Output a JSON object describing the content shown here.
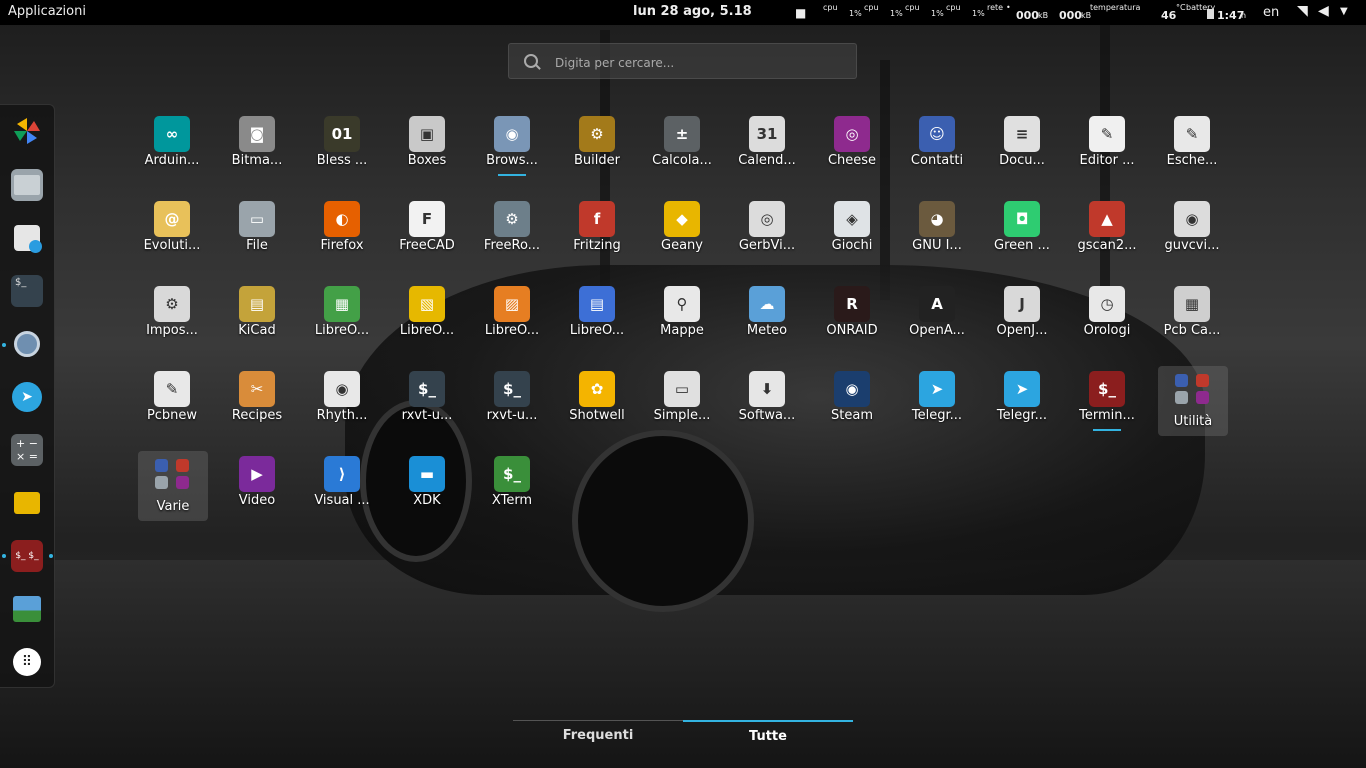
{
  "topbar": {
    "activities": "Applicazioni",
    "clock": "lun 28 ago,  5.18",
    "status": {
      "cpu_label": "cpu",
      "cpu_values": [
        "1%",
        "1%",
        "1%",
        "1%"
      ],
      "net_label": "rete",
      "net_down": "000",
      "net_down_unit": "kB",
      "net_up": "000",
      "net_up_unit": "kB",
      "temp_label": "temperatura",
      "temp_value": "46",
      "temp_unit": "°C",
      "battery_label": "battery",
      "battery_value": "1:47",
      "battery_unit": "h",
      "language": "en"
    }
  },
  "search": {
    "placeholder": "Digita per cercare..."
  },
  "dash": {
    "items": [
      "photos-icon",
      "files-icon",
      "software-icon",
      "terminal-icon",
      "chromium-icon",
      "telegram-icon",
      "calculator-icon",
      "geany-icon",
      "terminator-icon",
      "weather-icon",
      "show-apps-icon"
    ]
  },
  "apps": [
    [
      "Arduin...",
      "Bitma...",
      "Bless ...",
      "Boxes",
      "Brows...",
      "Builder",
      "Calcola...",
      "Calend...",
      "Cheese",
      "Contatti",
      "Docu...",
      "Editor ...",
      "Esche..."
    ],
    [
      "Evoluti...",
      "File",
      "Firefox",
      "FreeCAD",
      "FreeRo...",
      "Fritzing",
      "Geany",
      "GerbVi...",
      "Giochi",
      "GNU I...",
      "Green ...",
      "gscan2...",
      "guvcvi..."
    ],
    [
      "Impos...",
      "KiCad",
      "LibreO...",
      "LibreO...",
      "LibreO...",
      "LibreO...",
      "Mappe",
      "Meteo",
      "ONRAID",
      "OpenA...",
      "OpenJ...",
      "Orologi",
      "Pcb Ca..."
    ],
    [
      "Pcbnew",
      "Recipes",
      "Rhyth...",
      "rxvt-u...",
      "rxvt-u...",
      "Shotwell",
      "Simple...",
      "Softwa...",
      "Steam",
      "Telegr...",
      "Telegr...",
      "Termin...",
      "Utilità"
    ],
    [
      "Varie",
      "Video",
      "Visual ...",
      "XDK",
      "XTerm"
    ]
  ],
  "tabs": {
    "frequent": "Frequenti",
    "all": "Tutte"
  },
  "colors": {
    "accent": "#33b3e0",
    "topbar": "#000000"
  }
}
